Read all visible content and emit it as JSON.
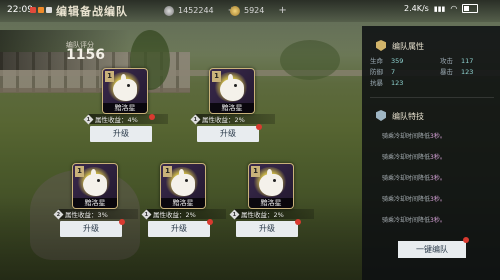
{
  "status_bar": {
    "time": "22:09",
    "network": "2.4K/s"
  },
  "header": {
    "title": "编辑备战编队",
    "currency_1": "1452244",
    "currency_2": "5924",
    "plus": "+"
  },
  "score": {
    "label": "编队评分",
    "value": "1156"
  },
  "heroes": [
    {
      "level": "1",
      "name": "黯洛星",
      "bonus_label": "属性收益：4%",
      "bonus_icon": "1",
      "button": "升级"
    },
    {
      "level": "1",
      "name": "黯洛星",
      "bonus_label": "属性收益：2%",
      "bonus_icon": "1",
      "button": "升级"
    },
    {
      "level": "1",
      "name": "黯洛星",
      "bonus_label": "属性收益：3%",
      "bonus_icon": "2",
      "button": "升级"
    },
    {
      "level": "1",
      "name": "黯洛星",
      "bonus_label": "属性收益：2%",
      "bonus_icon": "1",
      "button": "升级"
    },
    {
      "level": "1",
      "name": "黯洛星",
      "bonus_label": "属性收益：2%",
      "bonus_icon": "1",
      "button": "升级"
    }
  ],
  "panel": {
    "attr_title": "编队属性",
    "attrs": [
      {
        "label": "生命",
        "value": "359"
      },
      {
        "label": "攻击",
        "value": "117"
      },
      {
        "label": "防御",
        "value": "7"
      },
      {
        "label": "暴击",
        "value": "123"
      },
      {
        "label": "抗暴",
        "value": "123"
      }
    ],
    "skill_title": "编队特技",
    "skills": [
      {
        "text": "骑乘冷却时间降低",
        "highlight": "3秒。"
      },
      {
        "text": "骑乘冷却时间降低",
        "highlight": "3秒。"
      },
      {
        "text": "骑乘冷却时间降低",
        "highlight": "3秒。"
      },
      {
        "text": "骑乘冷却时间降低",
        "highlight": "3秒。"
      },
      {
        "text": "骑乘冷却时间降低",
        "highlight": "3秒。"
      }
    ],
    "auto_button": "一键编队"
  },
  "colors": {
    "accent_gold": "#c9b27a",
    "alert_red": "#d93a30",
    "attr_value": "#8fd3d0"
  }
}
